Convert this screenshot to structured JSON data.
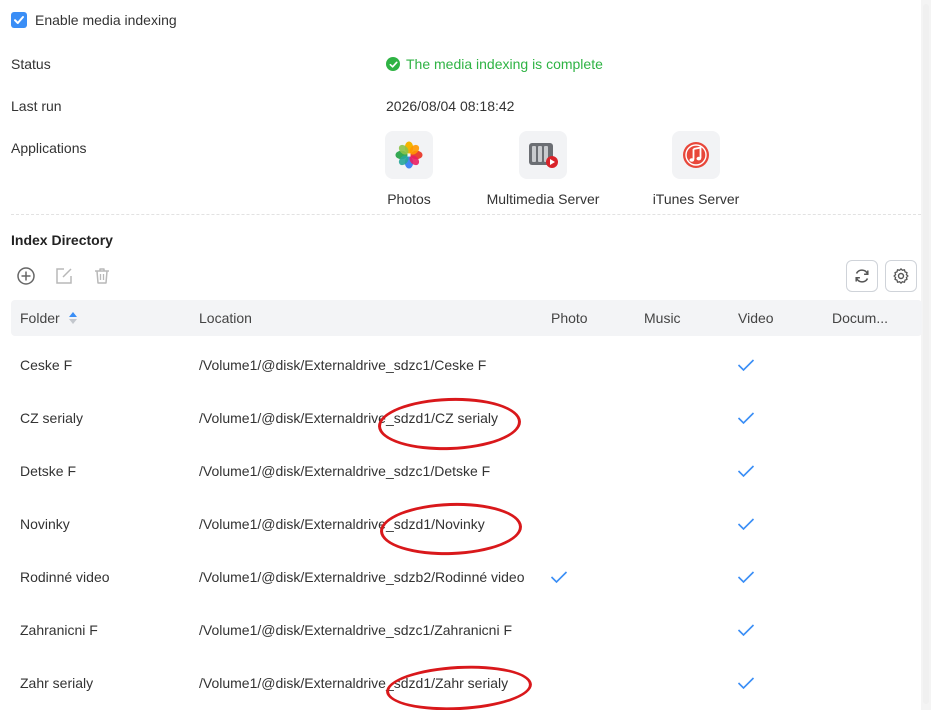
{
  "settings": {
    "enable_label": "Enable media indexing",
    "enable_checked": true,
    "status_label": "Status",
    "status_value": "The media indexing is complete",
    "last_run_label": "Last run",
    "last_run_value": "2026/08/04 08:18:42",
    "applications_label": "Applications"
  },
  "applications": [
    {
      "name": "Photos",
      "icon": "photos-icon"
    },
    {
      "name": "Multimedia Server",
      "icon": "multimedia-server-icon"
    },
    {
      "name": "iTunes Server",
      "icon": "itunes-server-icon"
    }
  ],
  "index_directory": {
    "title": "Index Directory",
    "toolbar": [
      "add-icon",
      "edit-icon",
      "delete-icon",
      "refresh-icon",
      "settings-icon"
    ],
    "columns": {
      "folder": "Folder",
      "location": "Location",
      "photo": "Photo",
      "music": "Music",
      "video": "Video",
      "documents": "Docum..."
    },
    "rows": [
      {
        "folder": "Ceske F",
        "location": "/Volume1/@disk/Externaldrive_sdzc1/Ceske F",
        "photo": false,
        "music": false,
        "video": true,
        "documents": false
      },
      {
        "folder": "CZ serialy",
        "location": "/Volume1/@disk/Externaldrive_sdzd1/CZ serialy",
        "photo": false,
        "music": false,
        "video": true,
        "documents": false
      },
      {
        "folder": "Detske F",
        "location": "/Volume1/@disk/Externaldrive_sdzc1/Detske F",
        "photo": false,
        "music": false,
        "video": true,
        "documents": false
      },
      {
        "folder": "Novinky",
        "location": "/Volume1/@disk/Externaldrive_sdzd1/Novinky",
        "photo": false,
        "music": false,
        "video": true,
        "documents": false
      },
      {
        "folder": "Rodinné video",
        "location": "/Volume1/@disk/Externaldrive_sdzb2/Rodinné video",
        "photo": true,
        "music": false,
        "video": true,
        "documents": false
      },
      {
        "folder": "Zahranicni F",
        "location": "/Volume1/@disk/Externaldrive_sdzc1/Zahranicni F",
        "photo": false,
        "music": false,
        "video": true,
        "documents": false
      },
      {
        "folder": "Zahr serialy",
        "location": "/Volume1/@disk/Externaldrive_sdzd1/Zahr serialy",
        "photo": false,
        "music": false,
        "video": true,
        "documents": false
      }
    ]
  },
  "colors": {
    "accent": "#3a8ef6",
    "success": "#2fb344",
    "annotation": "#d9181b"
  }
}
